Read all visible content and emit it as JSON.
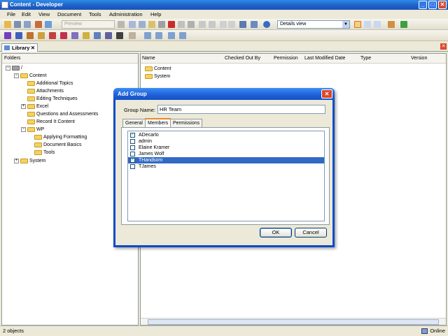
{
  "window": {
    "title": "Content - Developer"
  },
  "menubar": [
    "File",
    "Edit",
    "View",
    "Document",
    "Tools",
    "Administration",
    "Help"
  ],
  "toolbar": {
    "preview_label": "Preview",
    "view_combo": "Details view"
  },
  "library_tab": {
    "label": "Library",
    "close": "✕"
  },
  "folders": {
    "header": "Folders",
    "root": "/",
    "nodes": [
      "Content",
      "Additional Topics",
      "Attachments",
      "Editing Techniques",
      "Excel",
      "Questions and Assessments",
      "Record It Content",
      "WP",
      "Applying Formatting",
      "Document Basics",
      "Tools",
      "System"
    ]
  },
  "list": {
    "columns": [
      "Name",
      "Checked Out By",
      "Permission",
      "Last Modified Date",
      "Type",
      "Version"
    ],
    "rows": [
      "Content",
      "System"
    ]
  },
  "status": {
    "count": "2 objects",
    "mode": "Online"
  },
  "dialog": {
    "title": "Add Group",
    "group_name_label": "Group Name:",
    "group_name_value": "HR Team",
    "tabs": [
      "General",
      "Members",
      "Permissions"
    ],
    "members": [
      {
        "name": "ADecarlo",
        "checked": true
      },
      {
        "name": "admin",
        "checked": false
      },
      {
        "name": "Elaine Kramer",
        "checked": false
      },
      {
        "name": "James Wolf",
        "checked": false
      },
      {
        "name": "THandsom",
        "checked": true
      },
      {
        "name": "TJames",
        "checked": false
      }
    ],
    "ok_label": "OK",
    "cancel_label": "Cancel"
  },
  "colors": {
    "titlebar": "#1e5fc6",
    "selection": "#316ac5",
    "folder": "#f4d261"
  }
}
